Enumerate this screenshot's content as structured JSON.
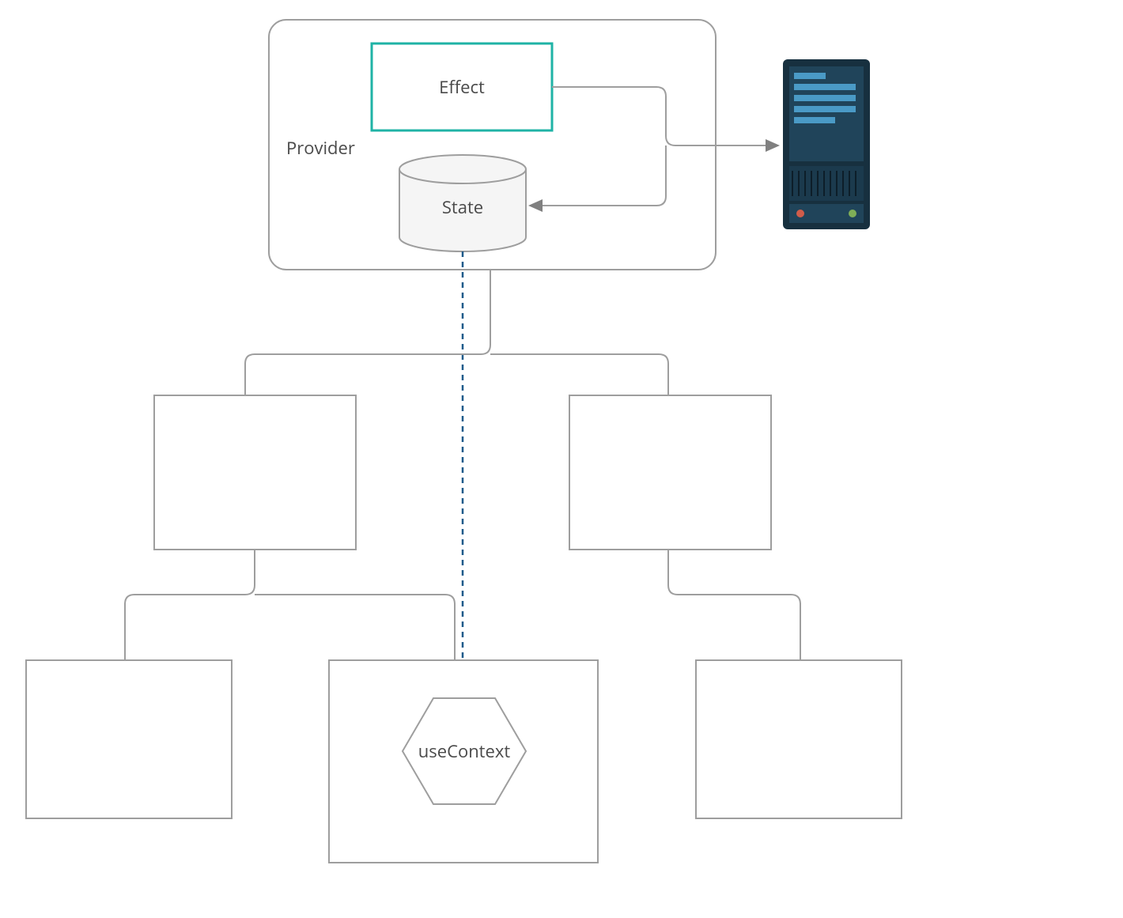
{
  "diagram": {
    "provider_label": "Provider",
    "effect_label": "Effect",
    "state_label": "State",
    "usecontext_label": "useContext"
  }
}
